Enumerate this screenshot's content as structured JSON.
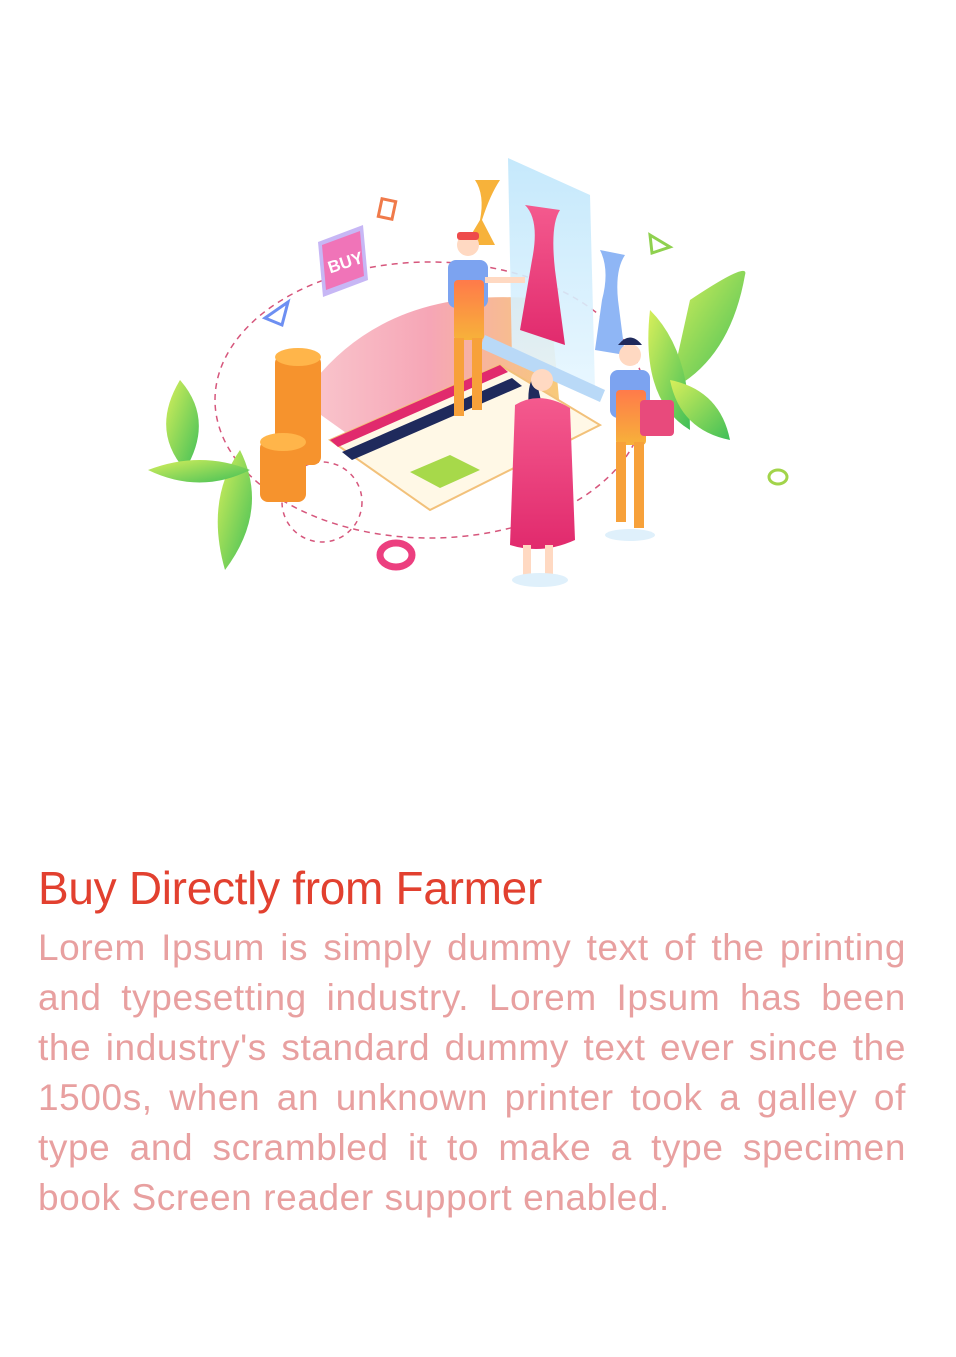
{
  "onboarding": {
    "illustration_label": "BUY",
    "title": "Buy Directly from Farmer",
    "description": "Lorem Ipsum is simply dummy text of the printing and typesetting industry. Lorem Ipsum has been the industry's standard dummy text ever since the 1500s, when an unknown printer took a galley of type and scrambled it to make a type specimen book Screen reader support enabled."
  },
  "colors": {
    "title": "#e2402f",
    "description": "#e8a0a0",
    "background": "#ffffff",
    "accent_pink": "#ec3f7f",
    "accent_orange": "#f7a13a",
    "accent_green": "#8fd14f"
  }
}
